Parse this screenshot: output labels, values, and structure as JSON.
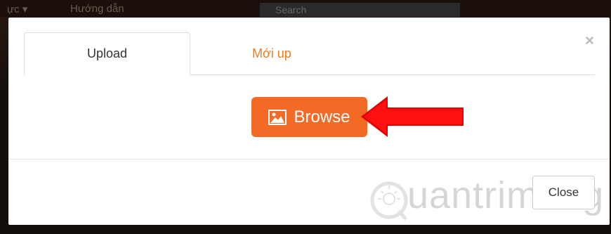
{
  "background": {
    "menu_1": "ực ▾",
    "menu_2": "Hướng dẫn",
    "search_text": "Search"
  },
  "modal": {
    "close_icon": "×",
    "tabs": [
      {
        "label": "Upload",
        "active": true
      },
      {
        "label": "Mới up",
        "active": false,
        "color": "#f27a1a"
      }
    ],
    "browse_button": {
      "label": "Browse",
      "icon": "image-icon",
      "color": "#f26a26"
    },
    "close_button": {
      "label": "Close"
    }
  },
  "watermark": {
    "text": "uantrimang",
    "logo": "lightbulb-q-logo"
  }
}
